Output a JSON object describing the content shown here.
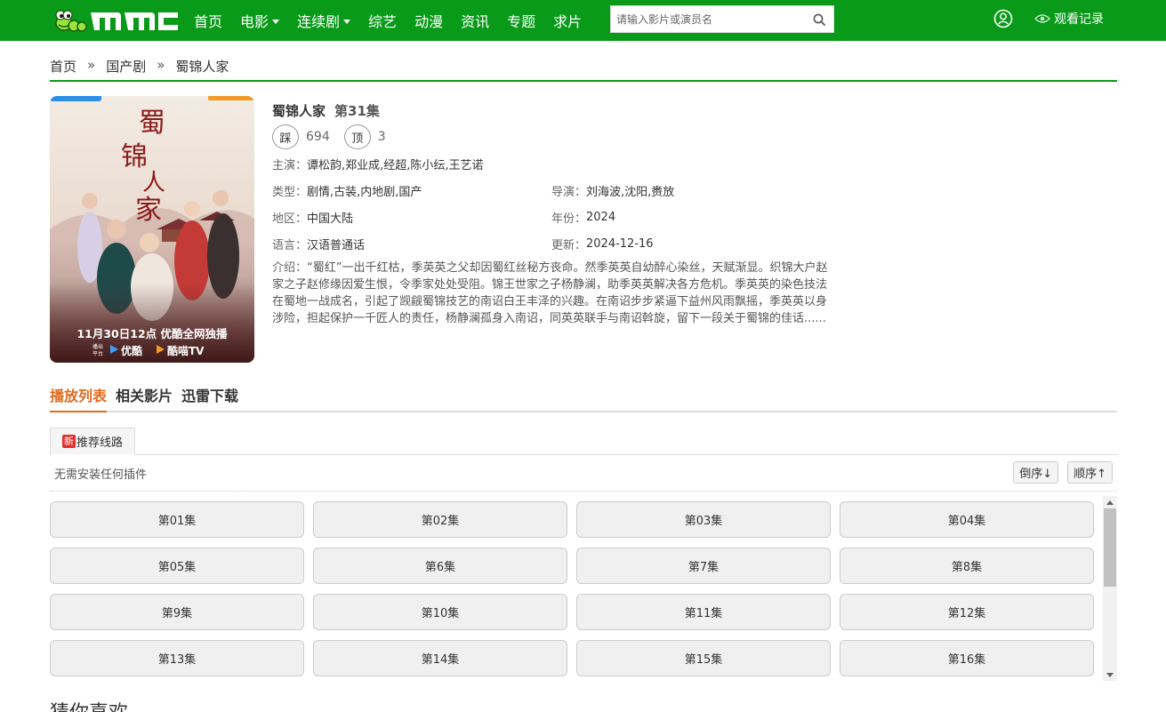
{
  "header": {
    "nav": [
      {
        "label": "首页",
        "has_dropdown": false
      },
      {
        "label": "电影",
        "has_dropdown": true
      },
      {
        "label": "连续剧",
        "has_dropdown": true
      },
      {
        "label": "综艺",
        "has_dropdown": false
      },
      {
        "label": "动漫",
        "has_dropdown": false
      },
      {
        "label": "资讯",
        "has_dropdown": false
      },
      {
        "label": "专题",
        "has_dropdown": false
      },
      {
        "label": "求片",
        "has_dropdown": false
      }
    ],
    "search_placeholder": "请输入影片或演员名",
    "search_icon": "search-icon",
    "user_icon": "user-icon",
    "history_label": "观看记录",
    "history_icon": "eye-icon",
    "brand_color": "#0a9a1a"
  },
  "breadcrumb": {
    "home": "首页",
    "category": "国产剧",
    "current": "蜀锦人家",
    "separator": "»"
  },
  "poster": {
    "title_calligraphy": "蜀锦人家",
    "premiere_text": "11月30日12点 优酷全网独播",
    "platform_label_line1": "播出",
    "platform_label_line2": "平台",
    "platform1": "优酷",
    "platform2": "酷喵TV"
  },
  "detail": {
    "title": "蜀锦人家",
    "episode": "第31集",
    "down_label": "踩",
    "down_count": "694",
    "up_label": "顶",
    "up_count": "3",
    "cast_label": "主演：",
    "cast": "谭松韵,郑业成,经超,陈小纭,王艺诺",
    "genre_label": "类型：",
    "genre": "剧情,古装,内地剧,国产",
    "director_label": "导演：",
    "director": "刘海波,沈阳,赉放",
    "region_label": "地区：",
    "region": "中国大陆",
    "year_label": "年份：",
    "year": "2024",
    "language_label": "语言：",
    "language": "汉语普通话",
    "updated_label": "更新：",
    "updated": "2024-12-16",
    "intro_label": "介绍：",
    "intro": "“蜀红”一出千红枯，季英英之父却因蜀红丝秘方丧命。然季英英自幼醉心染丝，天赋渐显。织锦大户赵家之子赵修缘因爱生恨，令季家处处受阻。锦王世家之子杨静澜，助季英英解决各方危机。季英英的染色技法在蜀地一战成名，引起了觊觎蜀锦技艺的南诏白王丰泽的兴趣。在南诏步步紧逼下益州风雨飘摇，季英英以身涉险，担起保护一千匠人的责任，杨静澜孤身入南诏，同英英联手与南诏斡旋，留下一段关于蜀锦的佳话......"
  },
  "tabs": [
    {
      "label": "播放列表",
      "active": true
    },
    {
      "label": "相关影片",
      "active": false
    },
    {
      "label": "迅雷下载",
      "active": false
    }
  ],
  "accent_color": "#e26a1c",
  "source": {
    "badge": "新",
    "label": "推荐线路",
    "plugin_text": "无需安装任何插件",
    "sort_desc": "倒序↓",
    "sort_asc": "顺序↑"
  },
  "episodes": [
    "第01集",
    "第02集",
    "第03集",
    "第04集",
    "第05集",
    "第6集",
    "第7集",
    "第8集",
    "第9集",
    "第10集",
    "第11集",
    "第12集",
    "第13集",
    "第14集",
    "第15集",
    "第16集"
  ],
  "guess_title": "猜你喜欢"
}
